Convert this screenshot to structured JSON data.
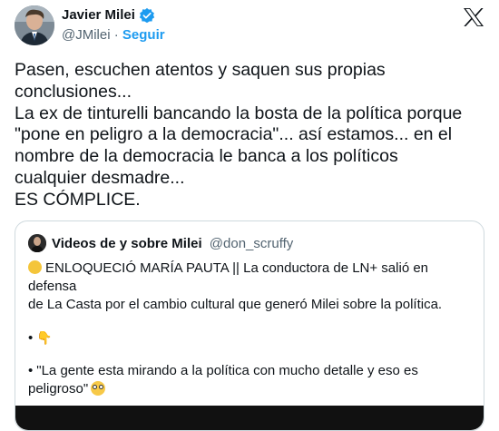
{
  "author": {
    "name": "Javier Milei",
    "handle": "@JMilei",
    "separator": "·",
    "follow_label": "Seguir"
  },
  "icons": {
    "avatar": "profile-photo",
    "verified": "verified-badge-icon",
    "x_logo": "x-logo-icon"
  },
  "colors": {
    "accent": "#1d9bf0",
    "text": "#0f1419",
    "secondary": "#536471",
    "border": "#cfd9de"
  },
  "tweet": {
    "lines": [
      "Pasen, escuchen atentos y saquen sus propias",
      "conclusiones...",
      "La ex de tinturelli bancando la bosta de la política porque",
      "\"pone en peligro a la democracia\"... así estamos... en el",
      "nombre de la democracia le banca a los políticos",
      "cualquier desmadre...",
      "ES CÓMPLICE."
    ]
  },
  "quote": {
    "name": "Videos de y sobre Milei",
    "handle": "@don_scruffy",
    "line1": "ENLOQUECIÓ MARÍA PAUTA || La conductora de LN+ salió en defensa",
    "line2": "de La Casta por el cambio cultural que generó Milei sobre la política.",
    "bullet": "•",
    "quote_line1": "\"La gente esta mirando a la política con mucho detalle y eso es",
    "quote_line2": "peligroso\""
  }
}
